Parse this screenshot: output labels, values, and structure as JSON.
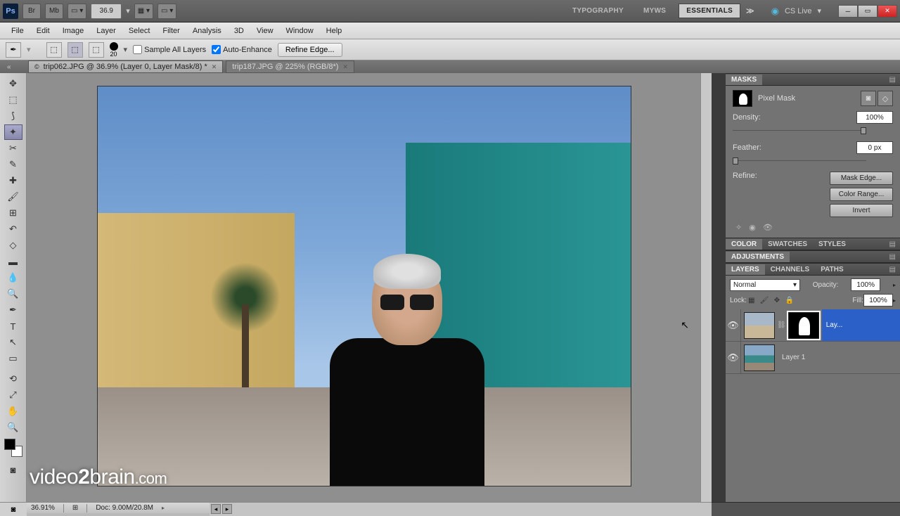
{
  "titlebar": {
    "zoom_input": "36.9",
    "workspaces": [
      "TYPOGRAPHY",
      "MYWS",
      "ESSENTIALS"
    ],
    "active_workspace": 2,
    "cslive": "CS Live"
  },
  "menubar": [
    "File",
    "Edit",
    "Image",
    "Layer",
    "Select",
    "Filter",
    "Analysis",
    "3D",
    "View",
    "Window",
    "Help"
  ],
  "options": {
    "brush_size": "20",
    "sample_all": "Sample All Layers",
    "auto_enhance": "Auto-Enhance",
    "refine_edge": "Refine Edge..."
  },
  "doc_tabs": [
    {
      "label": "trip062.JPG @ 36.9% (Layer 0, Layer Mask/8) *",
      "active": true
    },
    {
      "label": "trip187.JPG @ 225% (RGB/8*)",
      "active": false
    }
  ],
  "masks": {
    "title": "MASKS",
    "type": "Pixel Mask",
    "density_label": "Density:",
    "density_val": "100%",
    "feather_label": "Feather:",
    "feather_val": "0 px",
    "refine_label": "Refine:",
    "buttons": [
      "Mask Edge...",
      "Color Range...",
      "Invert"
    ]
  },
  "color_tabs": [
    "COLOR",
    "SWATCHES",
    "STYLES"
  ],
  "adjustments": "ADJUSTMENTS",
  "layer_tabs": [
    "LAYERS",
    "CHANNELS",
    "PATHS"
  ],
  "layers": {
    "blend": "Normal",
    "opacity_label": "Opacity:",
    "opacity_val": "100%",
    "lock_label": "Lock:",
    "fill_label": "Fill:",
    "fill_val": "100%",
    "items": [
      {
        "name": "Lay...",
        "selected": true,
        "has_mask": true
      },
      {
        "name": "Layer 1",
        "selected": false,
        "has_mask": false
      }
    ]
  },
  "status": {
    "zoom": "36.91%",
    "doc": "Doc: 9.00M/20.8M"
  },
  "watermark_a": "video",
  "watermark_b": "2",
  "watermark_c": "brain",
  "watermark_d": ".com"
}
